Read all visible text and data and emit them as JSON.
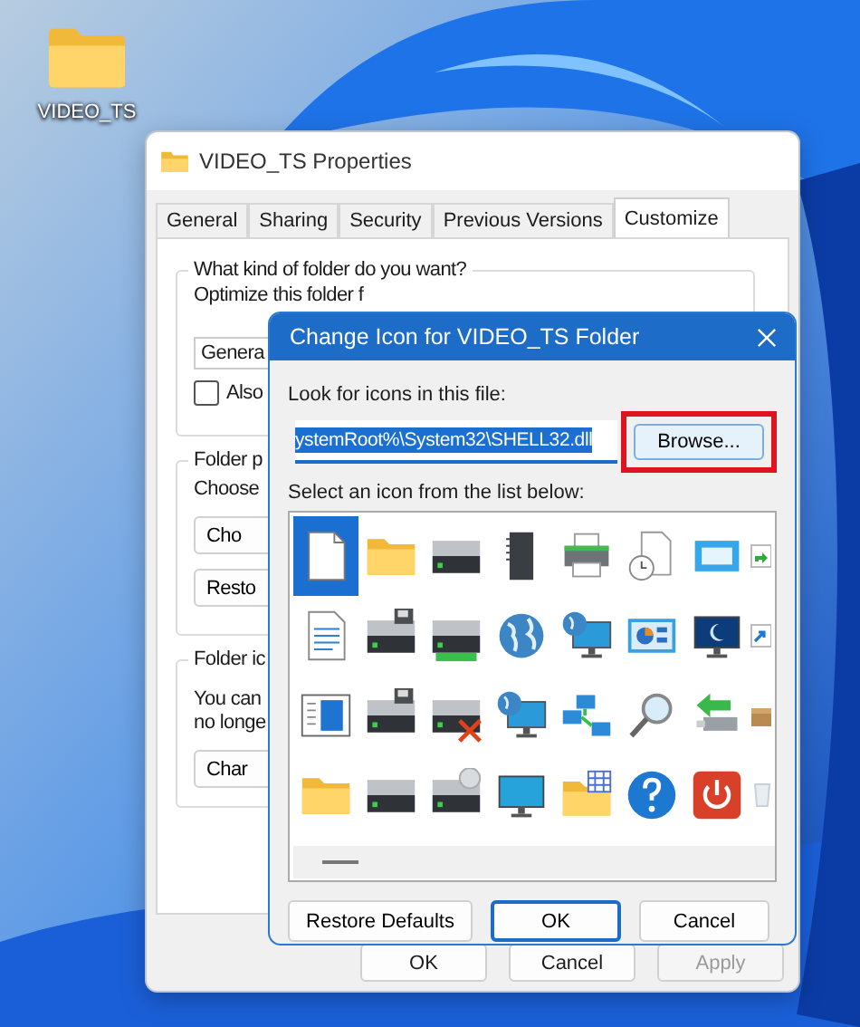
{
  "desktop": {
    "icon_label": "VIDEO_TS"
  },
  "properties_window": {
    "title": "VIDEO_TS Properties",
    "tabs": [
      {
        "label": "General",
        "selected": false
      },
      {
        "label": "Sharing",
        "selected": false
      },
      {
        "label": "Security",
        "selected": false
      },
      {
        "label": "Previous Versions",
        "selected": false
      },
      {
        "label": "Customize",
        "selected": true
      }
    ],
    "folder_type_group": {
      "legend": "What kind of folder do you want?",
      "optimize_label": "Optimize this folder f",
      "dropdown_value": "Genera",
      "checkbox": {
        "label": "Also",
        "checked": false
      }
    },
    "folder_pictures_group": {
      "legend": "Folder p",
      "text": "Choose",
      "buttons": [
        "Cho",
        "Resto"
      ]
    },
    "folder_icons_group": {
      "legend": "Folder ic",
      "text_lines": [
        "You can",
        "no longe"
      ],
      "button": "Char"
    },
    "buttons": [
      {
        "label": "OK",
        "disabled": false
      },
      {
        "label": "Cancel",
        "disabled": false
      },
      {
        "label": "Apply",
        "disabled": true
      }
    ]
  },
  "change_icon_dialog": {
    "title": "Change Icon for VIDEO_TS Folder",
    "file_label": "Look for icons in this file:",
    "file_value": "ystemRoot%\\System32\\SHELL32.dll",
    "browse_button": "Browse...",
    "list_label": "Select an icon from the list below:",
    "icons": [
      {
        "kind": "page",
        "selected": true
      },
      {
        "kind": "folder",
        "selected": false
      },
      {
        "kind": "drive",
        "selected": false
      },
      {
        "kind": "memory-card",
        "selected": false
      },
      {
        "kind": "printer",
        "selected": false
      },
      {
        "kind": "clock-page",
        "selected": false
      },
      {
        "kind": "window",
        "selected": false
      },
      {
        "kind": "share-arrow",
        "selected": false
      },
      {
        "kind": "text-page",
        "selected": false
      },
      {
        "kind": "floppy-drive",
        "selected": false
      },
      {
        "kind": "drive-bar",
        "selected": false
      },
      {
        "kind": "globe",
        "selected": false
      },
      {
        "kind": "globe-monitor",
        "selected": false
      },
      {
        "kind": "chart-panel",
        "selected": false
      },
      {
        "kind": "moon-monitor",
        "selected": false
      },
      {
        "kind": "shortcut-arrow",
        "selected": false
      },
      {
        "kind": "side-panel-page",
        "selected": false
      },
      {
        "kind": "floppy-drive",
        "selected": false
      },
      {
        "kind": "drive-cross",
        "selected": false
      },
      {
        "kind": "globe-monitor",
        "selected": false
      },
      {
        "kind": "network",
        "selected": false
      },
      {
        "kind": "magnifier",
        "selected": false
      },
      {
        "kind": "usb-arrow",
        "selected": false
      },
      {
        "kind": "box",
        "selected": false
      },
      {
        "kind": "folder",
        "selected": false
      },
      {
        "kind": "drive",
        "selected": false
      },
      {
        "kind": "drive-disc",
        "selected": false
      },
      {
        "kind": "monitor",
        "selected": false
      },
      {
        "kind": "folder-grid",
        "selected": false
      },
      {
        "kind": "help",
        "selected": false
      },
      {
        "kind": "power",
        "selected": false
      },
      {
        "kind": "bin",
        "selected": false
      }
    ],
    "buttons": [
      {
        "label": "Restore Defaults",
        "default": false
      },
      {
        "label": "OK",
        "default": true
      },
      {
        "label": "Cancel",
        "default": false
      }
    ]
  }
}
